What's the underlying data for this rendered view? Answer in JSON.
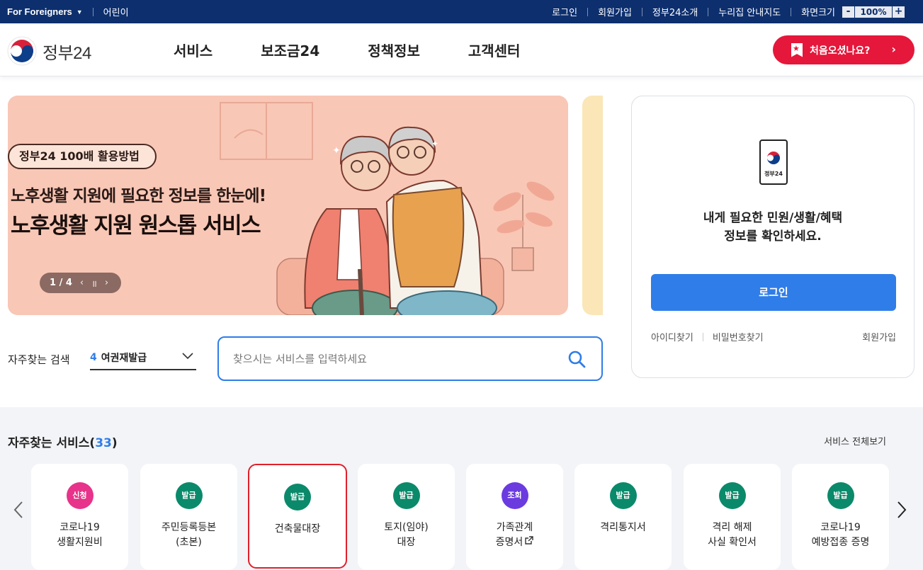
{
  "topbar": {
    "foreigners": "For Foreigners",
    "kids": "어린이",
    "links": [
      "로그인",
      "회원가입",
      "정부24소개",
      "누리집 안내지도"
    ],
    "zoom_label": "화면크기",
    "zoom_minus": "-",
    "zoom_value": "100%",
    "zoom_plus": "+"
  },
  "header": {
    "logo_text": "정부24",
    "nav": [
      "서비스",
      "보조금24",
      "정책정보",
      "고객센터"
    ],
    "first_visit": "처음오셨나요?"
  },
  "banner": {
    "pill": "정부24 100배 활용방법",
    "line1": "노후생활 지원에 필요한 정보를 한눈에!",
    "line2": "노후생활 지원 원스톱 서비스",
    "page": "1 / 4"
  },
  "login": {
    "device_caption": "정부24",
    "message_line1": "내게 필요한 민원/생활/혜택",
    "message_line2": "정보를 확인하세요.",
    "button": "로그인",
    "find_id": "아이디찾기",
    "find_pw": "비밀번호찾기",
    "join": "회원가입"
  },
  "frequent_search": {
    "label": "자주찾는 검색",
    "rank": "4",
    "value": "여권재발급",
    "placeholder": "찾으시는 서비스를 입력하세요"
  },
  "services": {
    "title": "자주찾는 서비스",
    "count_open": "(",
    "count": "33",
    "count_close": ")",
    "view_all": "서비스 전체보기",
    "items": [
      {
        "tag": "신청",
        "line1": "코로나19",
        "line2": "생활지원비"
      },
      {
        "tag": "발급",
        "line1": "주민등록등본",
        "line2": "(초본)"
      },
      {
        "tag": "발급",
        "line1": "건축물대장",
        "line2": ""
      },
      {
        "tag": "발급",
        "line1": "토지(임야)",
        "line2": "대장"
      },
      {
        "tag": "조회",
        "line1": "가족관계",
        "line2": "증명서"
      },
      {
        "tag": "발급",
        "line1": "격리통지서",
        "line2": ""
      },
      {
        "tag": "발급",
        "line1": "격리 해제",
        "line2": "사실 확인서"
      },
      {
        "tag": "발급",
        "line1": "코로나19",
        "line2": "예방접종 증명"
      }
    ]
  },
  "colors": {
    "topbar": "#0d2f6e",
    "accent_blue": "#2f7de8",
    "first_visit_red": "#e5173a",
    "issue_green": "#0a8a6a",
    "apply_pink": "#e8338a",
    "lookup_purple": "#6b3be0",
    "selected_border": "#e0202b"
  }
}
